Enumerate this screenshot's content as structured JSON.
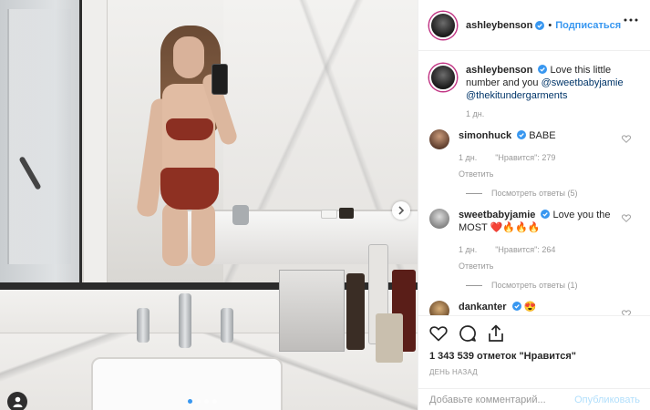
{
  "post": {
    "author": "ashleybenson",
    "follow_label": "Подписаться",
    "dot": "•",
    "caption_author": "ashleybenson",
    "caption_text": "Love this little number and you ",
    "caption_mention_1": "@sweetbabyjamie",
    "caption_mention_2": "@thekitundergarments",
    "caption_age": "1 дн.",
    "likes_text": "1 343 539 отметок \"Нравится\"",
    "posted_ago": "ДЕНЬ НАЗАД",
    "comment_placeholder": "Добавьте комментарий...",
    "publish_label": "Опубликовать"
  },
  "comments": [
    {
      "user": "simonhuck",
      "text": "BABE",
      "age": "1 дн.",
      "likes": "\"Нравится\": 279",
      "reply": "Ответить",
      "replies": "Посмотреть ответы (5)"
    },
    {
      "user": "sweetbabyjamie",
      "text": "Love you the MOST ❤️🔥🔥🔥",
      "age": "1 дн.",
      "likes": "\"Нравится\": 264",
      "reply": "Ответить",
      "replies": "Посмотреть ответы (1)"
    },
    {
      "user": "dankanter",
      "text": "😍"
    }
  ],
  "colors": {
    "link_blue": "#3897f0",
    "mention_blue": "#003569",
    "verified_blue": "#3897f0",
    "publish_disabled": "#b2dffc",
    "meta_gray": "#999999"
  },
  "icons": {
    "verified": "verified-badge-icon",
    "more": "more-options-icon",
    "like": "heart-icon",
    "comment": "comment-bubble-icon",
    "share": "share-icon",
    "save": "bookmark-icon",
    "next": "chevron-right-icon",
    "tag": "user-tag-icon"
  },
  "carousel": {
    "total_slides": 4,
    "active_slide": 1
  }
}
